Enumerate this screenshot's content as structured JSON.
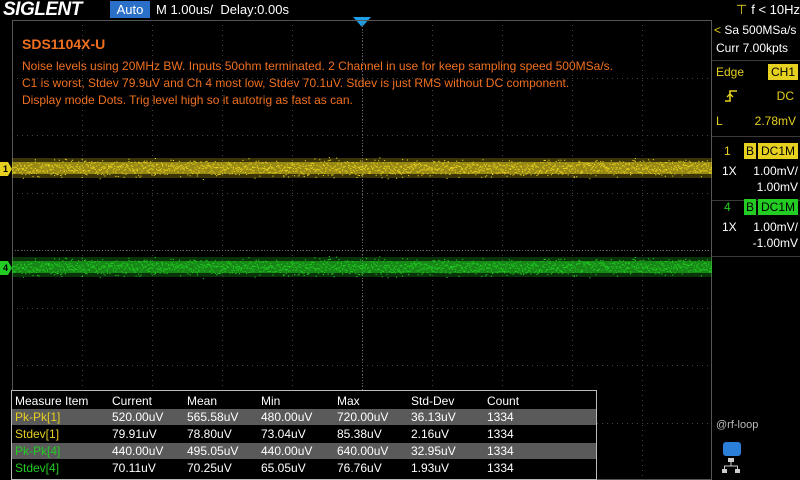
{
  "topbar": {
    "logo": "SIGLENT",
    "trigger_mode": "Auto",
    "timebase": "M 1.00us/",
    "delay": "Delay:0.00s",
    "frequency": "f < 10Hz",
    "trigger_icon": "t-icon"
  },
  "annotation": {
    "title": "SDS1104X-U",
    "lines": [
      "Noise levels using 20MHz BW. Inputs 50ohm terminated. 2 Channel in use for keep sampling speed 500MSa/s.",
      "C1 is worst, Stdev 79.9uV and Ch 4 most low, Stdev 70.1uV. Stdev is just RMS without DC component.",
      "Display mode Dots. Trig level high so it autotrig as fast as can."
    ]
  },
  "markers": {
    "ch1": "1",
    "ch4": "4"
  },
  "right_panel": {
    "sample_rate": "Sa 500MSa/s",
    "memory": "Curr 7.00kpts",
    "trigger_type": "Edge",
    "trigger_source": "CH1",
    "trigger_slope_icon": "rising-edge-icon",
    "trigger_coupling": "DC",
    "trigger_level_label": "L",
    "trigger_level": "2.78mV",
    "channels": [
      {
        "number": "1",
        "bw": "B",
        "coupling": "DC1M",
        "probe": "1X",
        "scale": "1.00mV/",
        "offset": "1.00mV",
        "color": "#e6d020"
      },
      {
        "number": "4",
        "bw": "B",
        "coupling": "DC1M",
        "probe": "1X",
        "scale": "1.00mV/",
        "offset": "-1.00mV",
        "color": "#22cc22"
      }
    ]
  },
  "measurements": {
    "headers": [
      "Measure Item",
      "Current",
      "Mean",
      "Min",
      "Max",
      "Std-Dev",
      "Count"
    ],
    "rows": [
      {
        "item": "Pk-Pk[1]",
        "current": "520.00uV",
        "mean": "565.58uV",
        "min": "480.00uV",
        "max": "720.00uV",
        "stddev": "36.13uV",
        "count": "1334",
        "color": "#e6d020"
      },
      {
        "item": "Stdev[1]",
        "current": "79.91uV",
        "mean": "78.80uV",
        "min": "73.04uV",
        "max": "85.38uV",
        "stddev": "2.16uV",
        "count": "1334",
        "color": "#e6d020"
      },
      {
        "item": "Pk-Pk[4]",
        "current": "440.00uV",
        "mean": "495.05uV",
        "min": "440.00uV",
        "max": "640.00uV",
        "stddev": "32.95uV",
        "count": "1334",
        "color": "#22cc22"
      },
      {
        "item": "Stdev[4]",
        "current": "70.11uV",
        "mean": "70.25uV",
        "min": "65.05uV",
        "max": "76.76uV",
        "stddev": "1.93uV",
        "count": "1334",
        "color": "#22cc22"
      }
    ]
  },
  "watermark": "@rf-loop",
  "colors": {
    "ch1": "#e6d020",
    "ch4": "#22cc22",
    "annotation": "#f07020",
    "accent": "#2a70c8"
  }
}
